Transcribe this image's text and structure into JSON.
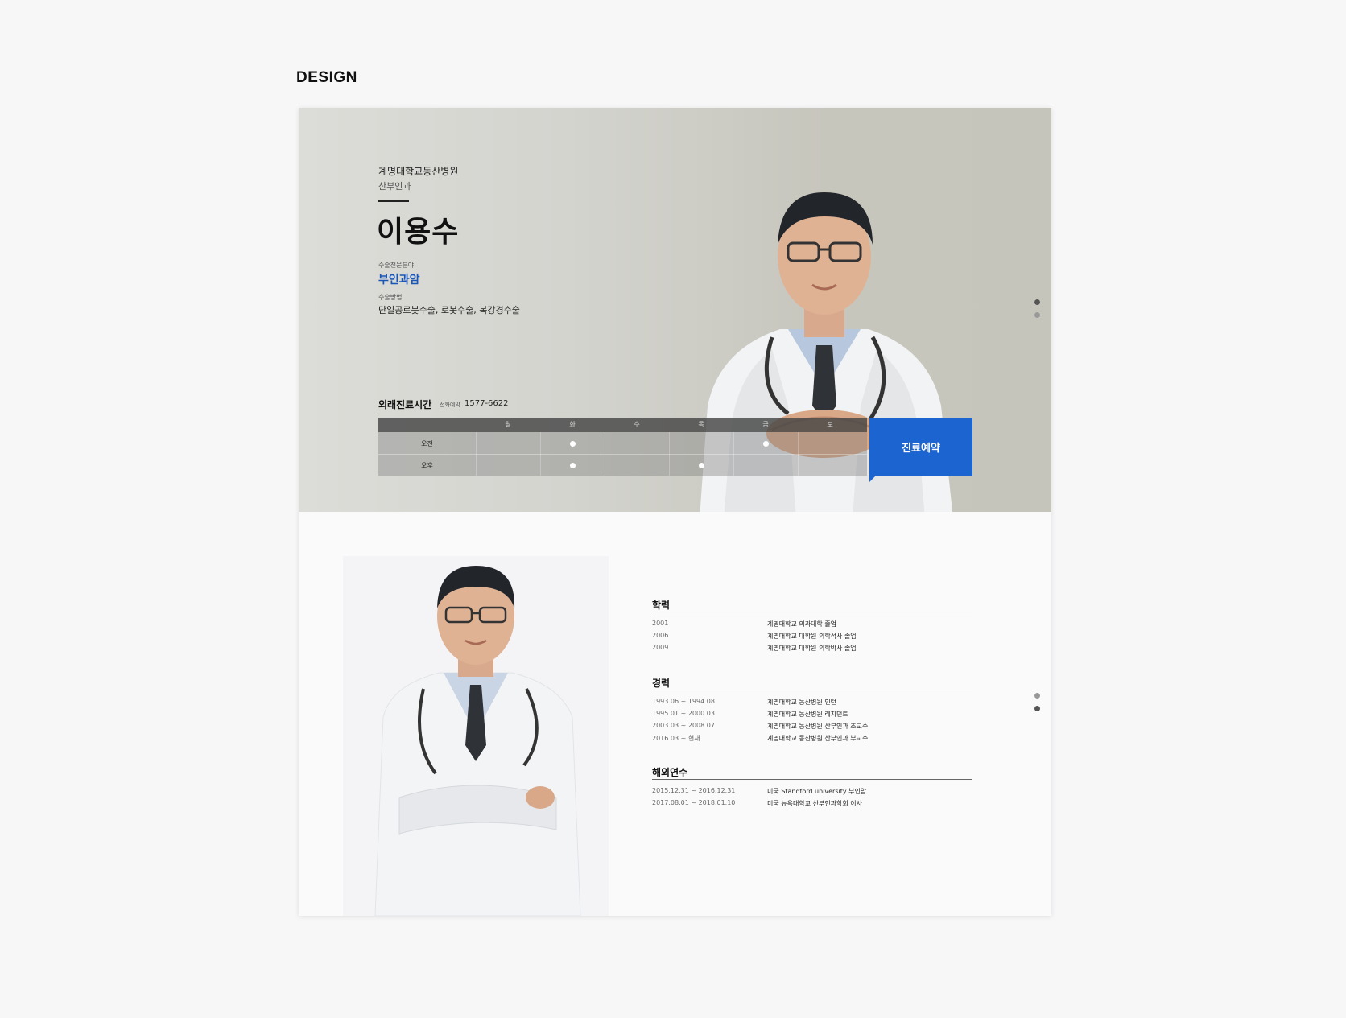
{
  "page_label": "DESIGN",
  "hero": {
    "hospital": "계명대학교동산병원",
    "department": "산부인과",
    "doctor_name": "이용수",
    "specialty_label": "수술전문분야",
    "specialty": "부인과암",
    "method_label": "수술방법",
    "methods": "단일공로봇수술, 로봇수술, 복강경수술",
    "hours_title": "외래진료시간",
    "tel_label": "전화예약",
    "tel": "1577-6622",
    "reserve_label": "진료예약"
  },
  "schedule": {
    "days": [
      "월",
      "화",
      "수",
      "목",
      "금",
      "토"
    ],
    "periods": [
      {
        "label": "오전",
        "available": [
          false,
          true,
          false,
          false,
          true,
          false
        ]
      },
      {
        "label": "오후",
        "available": [
          false,
          true,
          false,
          true,
          false,
          false
        ]
      }
    ]
  },
  "career": {
    "education": {
      "title": "학력",
      "items": [
        {
          "date": "2001",
          "text": "계명대학교 의과대학 졸업"
        },
        {
          "date": "2006",
          "text": "계명대학교 대학원 의학석사 졸업"
        },
        {
          "date": "2009",
          "text": "계명대학교 대학원 의학박사 졸업"
        }
      ]
    },
    "experience": {
      "title": "경력",
      "items": [
        {
          "date": "1993.06 ~ 1994.08",
          "text": "계명대학교 동산병원 인턴"
        },
        {
          "date": "1995.01 ~ 2000.03",
          "text": "계명대학교 동산병원 레지던트"
        },
        {
          "date": "2003.03 ~ 2008.07",
          "text": "계명대학교 동산병원 산부인과 조교수"
        },
        {
          "date": "2016.03 ~ 현재",
          "text": "계명대학교 동산병원 산부인과 부교수"
        }
      ]
    },
    "overseas": {
      "title": "해외연수",
      "items": [
        {
          "date": "2015.12.31 ~ 2016.12.31",
          "text": "미국 Standford university 부인암"
        },
        {
          "date": "2017.08.01 ~ 2018.01.10",
          "text": "미국 뉴욕대학교 산부인과학회 이사"
        }
      ]
    }
  },
  "colors": {
    "accent": "#1c64cf",
    "specialty": "#1a56b8"
  }
}
